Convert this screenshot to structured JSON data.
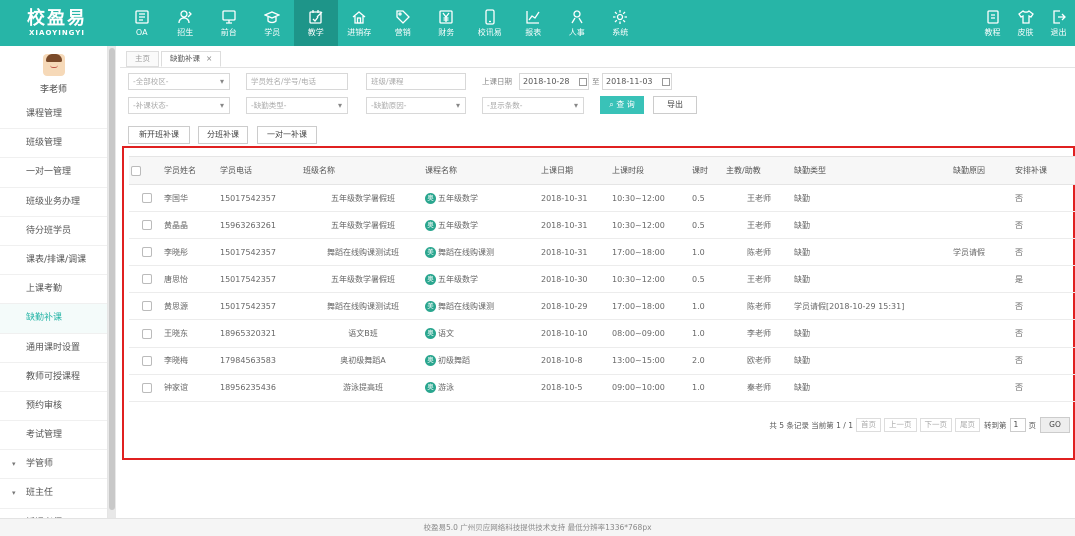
{
  "logo": {
    "cn": "校盈易",
    "en": "XIAOYINGYI"
  },
  "nav": [
    {
      "label": "OA",
      "icon": "oa-icon"
    },
    {
      "label": "招生",
      "icon": "enroll-icon"
    },
    {
      "label": "前台",
      "icon": "monitor-icon"
    },
    {
      "label": "学员",
      "icon": "graduation-cap-icon"
    },
    {
      "label": "教学",
      "icon": "teaching-icon",
      "active": true
    },
    {
      "label": "进销存",
      "icon": "house-icon"
    },
    {
      "label": "营销",
      "icon": "tag-icon"
    },
    {
      "label": "财务",
      "icon": "yen-icon"
    },
    {
      "label": "校讯易",
      "icon": "phone-icon"
    },
    {
      "label": "报表",
      "icon": "chart-icon"
    },
    {
      "label": "人事",
      "icon": "person-icon"
    },
    {
      "label": "系统",
      "icon": "gear-icon"
    }
  ],
  "top_right": [
    {
      "label": "教程",
      "icon": "tutorial-icon"
    },
    {
      "label": "皮肤",
      "icon": "shirt-icon"
    },
    {
      "label": "退出",
      "icon": "logout-icon"
    }
  ],
  "sidebar": {
    "teacher": "李老师",
    "items": [
      {
        "label": "课程管理"
      },
      {
        "label": "班级管理"
      },
      {
        "label": "一对一管理"
      },
      {
        "label": "班级业务办理"
      },
      {
        "label": "待分班学员"
      },
      {
        "label": "课表/排课/调课"
      },
      {
        "label": "上课考勤"
      },
      {
        "label": "缺勤补课",
        "active": true
      },
      {
        "label": "通用课时设置"
      },
      {
        "label": "教师可授课程"
      },
      {
        "label": "预约审核"
      },
      {
        "label": "考试管理"
      },
      {
        "label": "学管师",
        "group": true
      },
      {
        "label": "班主任",
        "group": true
      },
      {
        "label": "授课老师",
        "group": true
      }
    ]
  },
  "tabs": [
    {
      "label": "主页"
    },
    {
      "label": "缺勤补课",
      "close": "×",
      "active": true
    }
  ],
  "filters": {
    "campus": "-全部校区-",
    "student_search": "学员姓名/学号/电话",
    "class_course": "班级/课程",
    "date_label": "上课日期",
    "date_from": "2018-10-28",
    "date_sep": "至",
    "date_to": "2018-11-03",
    "makeup_status": "-补课状态-",
    "absence_type": "-缺勤类型-",
    "absence_reason": "-缺勤原因-",
    "show_count": "-显示条数-",
    "query": "查 询",
    "export": "导出"
  },
  "actions": {
    "new_class": "新开班补课",
    "split_class": "分班补课",
    "one_on_one": "一对一补课"
  },
  "table": {
    "headers": [
      "学员姓名",
      "学员电话",
      "班级名称",
      "课程名称",
      "上课日期",
      "上课时段",
      "课时",
      "主教/助教",
      "缺勤类型",
      "缺勤原因",
      "安排补课"
    ],
    "rows": [
      {
        "name": "李国华",
        "phone": "15017542357",
        "class": "五年级数学暑假班",
        "course_icon": "奥",
        "course": "五年级数学",
        "date": "2018-10-31",
        "time": "10:30~12:00",
        "hours": "0.5",
        "teacher": "王老师",
        "type": "缺勤",
        "reason": "",
        "makeup": "否"
      },
      {
        "name": "黄晶晶",
        "phone": "15963263261",
        "class": "五年级数学暑假班",
        "course_icon": "奥",
        "course": "五年级数学",
        "date": "2018-10-31",
        "time": "10:30~12:00",
        "hours": "0.5",
        "teacher": "王老师",
        "type": "缺勤",
        "reason": "",
        "makeup": "否"
      },
      {
        "name": "李晓彤",
        "phone": "15017542357",
        "class": "舞蹈在线购课测试班",
        "course_icon": "美",
        "course": "舞蹈在线购课测",
        "date": "2018-10-31",
        "time": "17:00~18:00",
        "hours": "1.0",
        "teacher": "陈老师",
        "type": "缺勤",
        "reason": "学员请假",
        "makeup": "否"
      },
      {
        "name": "唐思怡",
        "phone": "15017542357",
        "class": "五年级数学暑假班",
        "course_icon": "奥",
        "course": "五年级数学",
        "date": "2018-10-30",
        "time": "10:30~12:00",
        "hours": "0.5",
        "teacher": "王老师",
        "type": "缺勤",
        "reason": "",
        "makeup": "是"
      },
      {
        "name": "黄思源",
        "phone": "15017542357",
        "class": "舞蹈在线购课测试班",
        "course_icon": "美",
        "course": "舞蹈在线购课测",
        "date": "2018-10-29",
        "time": "17:00~18:00",
        "hours": "1.0",
        "teacher": "陈老师",
        "type": "学员请假[2018-10-29 15:31]",
        "reason": "",
        "makeup": "否"
      },
      {
        "name": "王晓东",
        "phone": "18965320321",
        "class": "语文B班",
        "course_icon": "奥",
        "course": "语文",
        "date": "2018-10-10",
        "time": "08:00~09:00",
        "hours": "1.0",
        "teacher": "李老师",
        "type": "缺勤",
        "reason": "",
        "makeup": "否"
      },
      {
        "name": "李晓梅",
        "phone": "17984563583",
        "class": "奥初级舞蹈A",
        "course_icon": "奥",
        "course": "初级舞蹈",
        "date": "2018-10-8",
        "time": "13:00~15:00",
        "hours": "2.0",
        "teacher": "欧老师",
        "type": "缺勤",
        "reason": "",
        "makeup": "否"
      },
      {
        "name": "钟家谊",
        "phone": "18956235436",
        "class": "游泳提高班",
        "course_icon": "奥",
        "course": "游泳",
        "date": "2018-10-5",
        "time": "09:00~10:00",
        "hours": "1.0",
        "teacher": "秦老师",
        "type": "缺勤",
        "reason": "",
        "makeup": "否"
      }
    ]
  },
  "pager": {
    "summary": "共 5 条记录 当前第 1 / 1",
    "first": "首页",
    "prev": "上一页",
    "next": "下一页",
    "last": "尾页",
    "goto": "转到第",
    "page": "1",
    "page_unit": "页",
    "go": "GO"
  },
  "footer": "校盈易5.0    广州贝应网络科技提供技术支持    最低分辨率1336*768px",
  "colors": {
    "brand": "#27b5a7",
    "active_nav": "#1e9589",
    "highlight": "#e02020",
    "query_btn": "#39c2b8"
  }
}
